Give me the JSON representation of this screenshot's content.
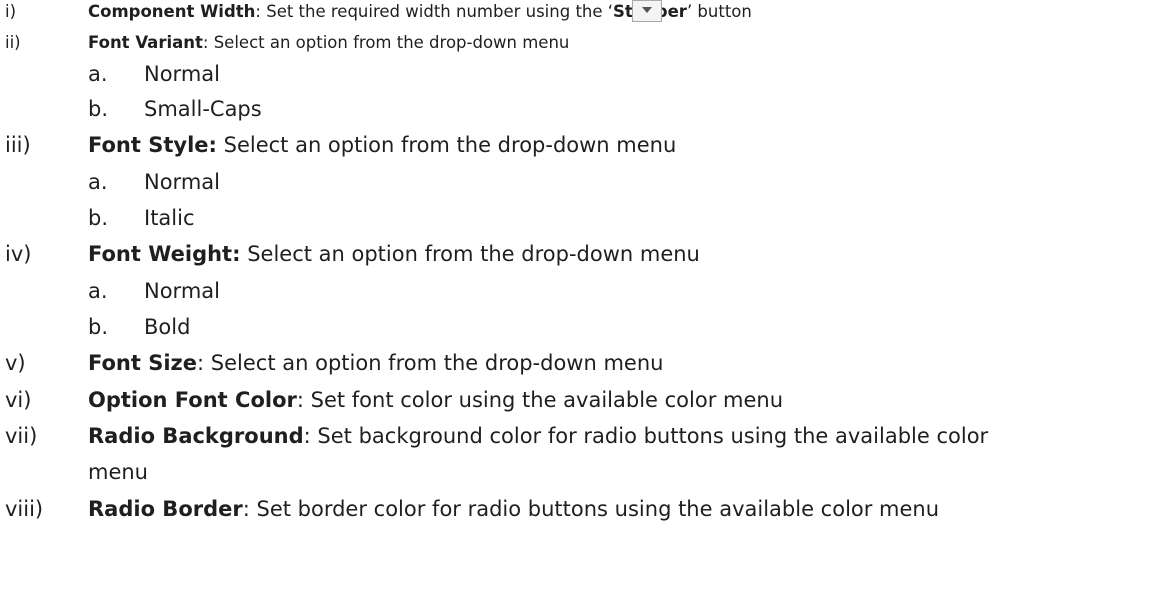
{
  "items": [
    {
      "num": "i)",
      "label": "Component Width",
      "sep": ": ",
      "text_before": "Set the required width number using the ",
      "quoted": "Stepper",
      "text_after": " button"
    },
    {
      "num": "ii)",
      "label": "Font Variant",
      "sep": ": ",
      "text": "Select an option from the drop-down menu",
      "subs": [
        {
          "letter": "a.",
          "text": "Normal"
        },
        {
          "letter": "b.",
          "text": "Small-Caps"
        }
      ]
    },
    {
      "num": "iii)",
      "label": "Font Style:",
      "sep": " ",
      "text": "Select an option from the drop-down menu",
      "subs": [
        {
          "letter": "a.",
          "text": "Normal"
        },
        {
          "letter": "b.",
          "text": "Italic"
        }
      ]
    },
    {
      "num": "iv)",
      "label": "Font Weight:",
      "sep": " ",
      "text": "Select an option from the drop-down menu",
      "subs": [
        {
          "letter": "a.",
          "text": "Normal"
        },
        {
          "letter": "b.",
          "text": "Bold"
        }
      ]
    },
    {
      "num": "v)",
      "label": "Font Size",
      "sep": ": ",
      "text": "Select an option from the drop-down menu"
    },
    {
      "num": "vi)",
      "label": "Option Font Color",
      "sep": ": ",
      "text": "Set font color using the available color menu"
    },
    {
      "num": "vii)",
      "label": "Radio Background",
      "sep": ": ",
      "text": "Set background color for radio buttons using the available color",
      "text_line2": "menu"
    },
    {
      "num": "viii)",
      "label": "Radio Border",
      "sep": ": ",
      "text": "Set border color for radio buttons using the available color menu"
    }
  ],
  "stepper_icon": "stepper-spin-icon"
}
